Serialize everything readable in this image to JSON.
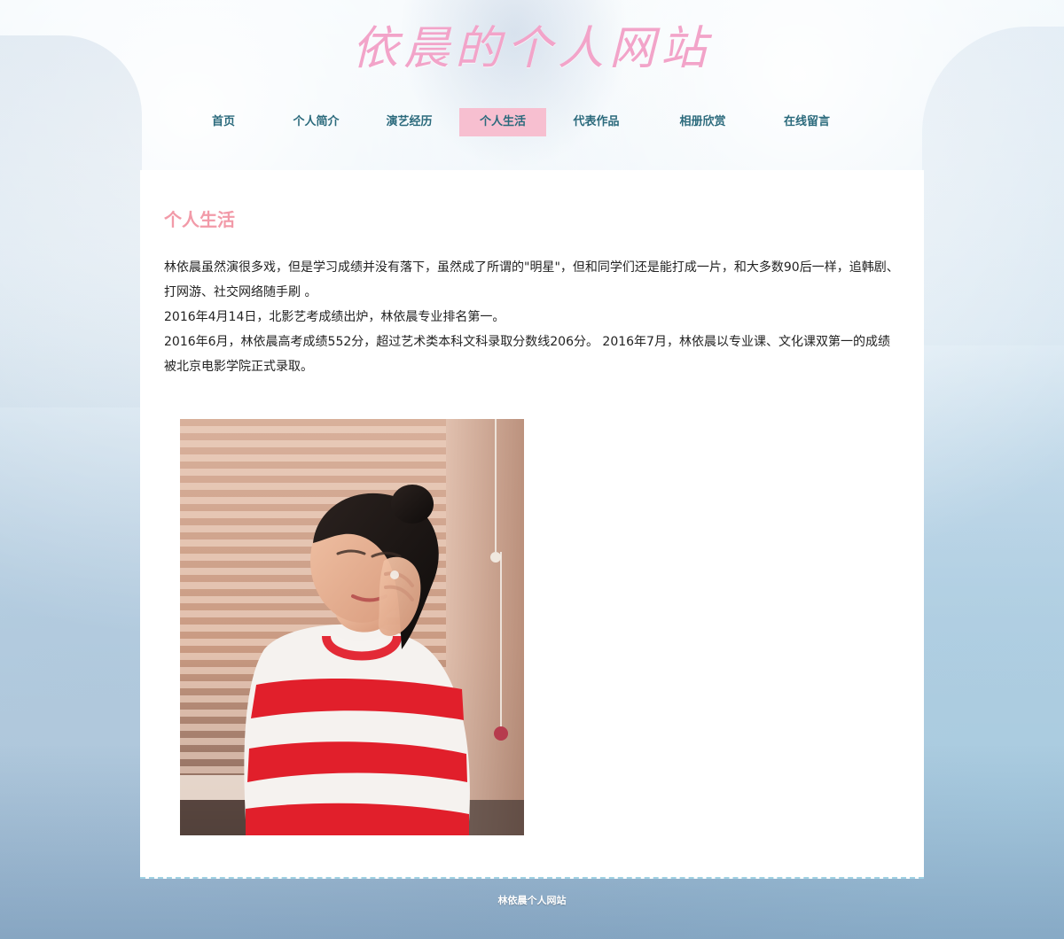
{
  "site": {
    "title": "依晨的个人网站"
  },
  "nav": {
    "items": [
      {
        "label": "首页"
      },
      {
        "label": "个人简介"
      },
      {
        "label": "演艺经历"
      },
      {
        "label": "个人生活",
        "active": true
      },
      {
        "label": "代表作品"
      },
      {
        "label": "相册欣赏"
      },
      {
        "label": "在线留言"
      }
    ]
  },
  "main": {
    "section_title": "个人生活",
    "paragraphs": [
      "林依晨虽然演很多戏，但是学习成绩并没有落下，虽然成了所谓的\"明星\"，但和同学们还是能打成一片，和大多数90后一样，追韩剧、打网游、社交网络随手刷 。",
      "2016年4月14日，北影艺考成绩出炉，林依晨专业排名第一。",
      "2016年6月，林依晨高考成绩552分，超过艺术类本科文科录取分数线206分。 2016年7月，林依晨以专业课、文化课双第一的成绩被北京电影学院正式录取。"
    ]
  },
  "footer": {
    "text": "林依晨个人网站"
  },
  "colors": {
    "title_pink": "#f2a4c9",
    "nav_text": "#2b6a7c",
    "nav_active_bg": "#f7bfd0",
    "section_title": "#f29aa8",
    "footer_border": "#9fd1e3"
  }
}
